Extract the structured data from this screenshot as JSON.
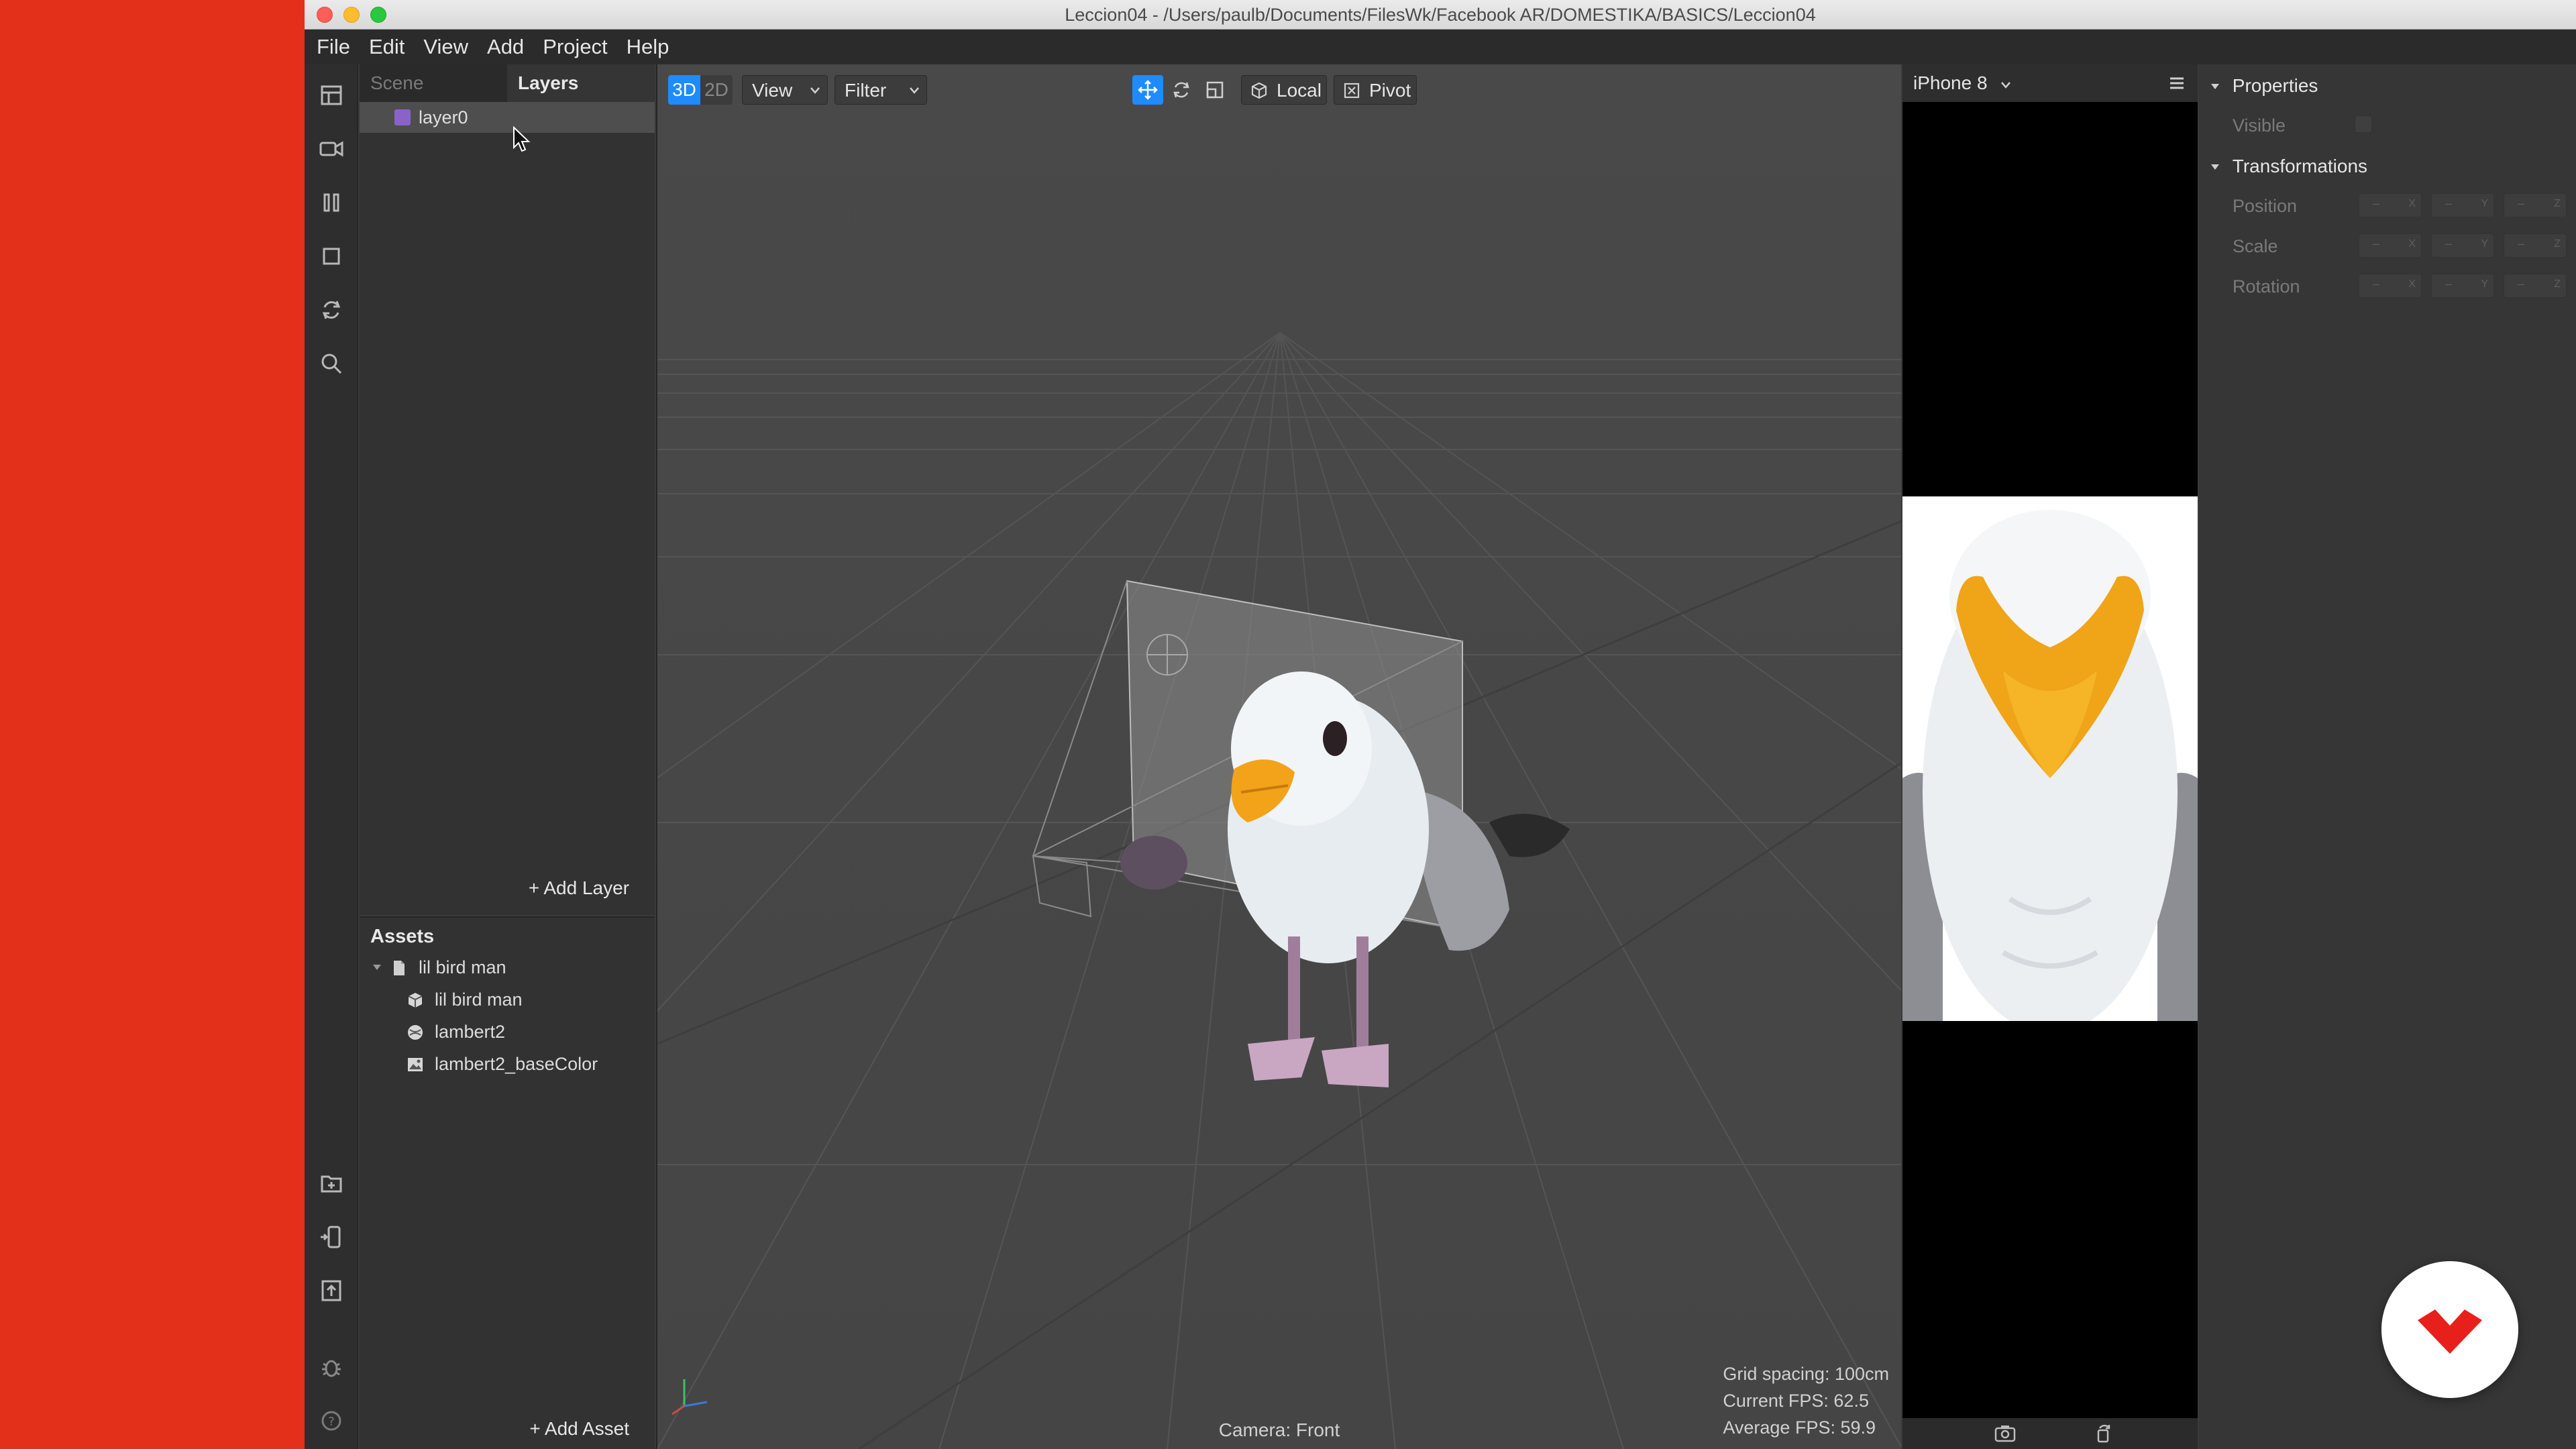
{
  "window": {
    "title": "Leccion04 - /Users/paulb/Documents/FilesWk/Facebook AR/DOMESTIKA/BASICS/Leccion04"
  },
  "menu": [
    "File",
    "Edit",
    "View",
    "Add",
    "Project",
    "Help"
  ],
  "layers_panel": {
    "tabs": [
      "Scene",
      "Layers"
    ],
    "active_tab": "Layers",
    "layers": [
      {
        "name": "layer0",
        "color": "#8a63c9"
      }
    ],
    "add_layer": "+ Add Layer"
  },
  "assets_panel": {
    "title": "Assets",
    "items": [
      {
        "name": "lil bird man",
        "icon": "file-icon",
        "expanded": true
      },
      {
        "name": "lil bird man",
        "icon": "mesh-cube-icon"
      },
      {
        "name": "lambert2",
        "icon": "material-sphere-icon"
      },
      {
        "name": "lambert2_baseColor",
        "icon": "texture-image-icon"
      }
    ],
    "add_asset": "+ Add Asset"
  },
  "viewport": {
    "mode_3d": "3D",
    "mode_2d": "2D",
    "active_mode": "3D",
    "view_menu": "View",
    "filter_menu": "Filter",
    "transform_tools": [
      "move-icon",
      "rotate-icon",
      "scale-icon"
    ],
    "active_tool": "move-icon",
    "space_button": "Local",
    "pivot_button": "Pivot",
    "camera": "Camera: Front",
    "grid_spacing": "Grid spacing: 100cm",
    "current_fps": "Current FPS: 62.5",
    "average_fps": "Average FPS: 59.9"
  },
  "simulator": {
    "device": "iPhone 8"
  },
  "properties": {
    "section_title": "Properties",
    "visible_label": "Visible",
    "transform_title": "Transformations",
    "rows": [
      {
        "label": "Position",
        "values": [
          "–",
          "–",
          "–"
        ],
        "axes": [
          "X",
          "Y",
          "Z"
        ]
      },
      {
        "label": "Scale",
        "values": [
          "–",
          "–",
          "–"
        ],
        "axes": [
          "X",
          "Y",
          "Z"
        ]
      },
      {
        "label": "Rotation",
        "values": [
          "–",
          "–",
          "–"
        ],
        "axes": [
          "X",
          "Y",
          "Z"
        ]
      }
    ]
  },
  "colors": {
    "desktop": "#e2301b",
    "accent": "#1e8bff",
    "viewport_bg": "#494949"
  }
}
